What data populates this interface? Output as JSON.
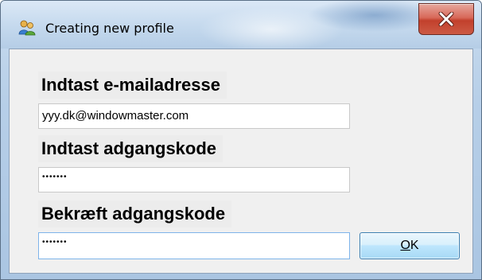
{
  "window": {
    "title": "Creating new profile",
    "icon": "users-profile-icon",
    "close_icon": "close-icon"
  },
  "form": {
    "email_label": "Indtast e-mailadresse",
    "email_value": "yyy.dk@windowmaster.com",
    "password_label": "Indtast adgangskode",
    "password_value": "•••••••",
    "confirm_label": "Bekræft adgangskode",
    "confirm_value": "•••••••"
  },
  "buttons": {
    "ok_mnemonic": "O",
    "ok_rest": "K"
  },
  "colors": {
    "close_button": "#c2402c",
    "ok_button_border": "#3c7fb1",
    "active_field_border": "#7eb4ea"
  }
}
